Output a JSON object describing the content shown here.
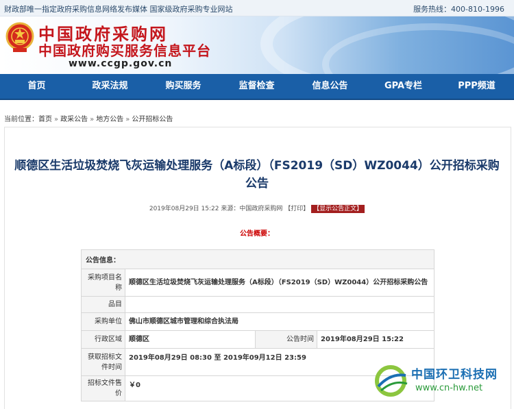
{
  "topbar": {
    "left": "财政部唯一指定政府采购信息网络发布媒体  国家级政府采购专业网站",
    "hotline": "服务热线：400-810-1996"
  },
  "banner": {
    "title1": "中国政府采购网",
    "title2": "中国政府购买服务信息平台",
    "url": "www.ccgp.gov.cn"
  },
  "nav": [
    "首页",
    "政采法规",
    "购买服务",
    "监督检查",
    "信息公告",
    "GPA专栏",
    "PPP频道"
  ],
  "breadcrumb": {
    "prefix": "当前位置：",
    "items": [
      "首页",
      "政采公告",
      "地方公告",
      "公开招标公告"
    ],
    "separator": "»"
  },
  "article": {
    "title": "顺德区生活垃圾焚烧飞灰运输处理服务（A标段）（FS2019（SD）WZ0044）公开招标采购公告",
    "date": "2019年08月29日 15:22",
    "source": "来源：中国政府采购网",
    "print": "【打印】",
    "show_text": "【显示公告正文】",
    "summary_label": "公告概要："
  },
  "table": {
    "section": "公告信息：",
    "rows": {
      "project_name_label": "采购项目名称",
      "project_name": "顺德区生活垃圾焚烧飞灰运输处理服务（A标段）（FS2019（SD）WZ0044）公开招标采购公告",
      "category_label": "品目",
      "category": "",
      "purchaser_label": "采购单位",
      "purchaser": "佛山市顺德区城市管理和综合执法局",
      "region_label": "行政区域",
      "region": "顺德区",
      "pub_time_label": "公告时间",
      "pub_time": "2019年08月29日  15:22",
      "doc_time_label": "获取招标文件时间",
      "doc_time": "2019年08月29日 08:30  至  2019年09月12日 23:59",
      "price_label": "招标文件售价",
      "price": "￥0"
    }
  },
  "watermark": {
    "name": "中国环卫科技网",
    "url": "www.cn-hw.net"
  },
  "colors": {
    "nav_bg": "#1a5fa7",
    "title_red": "#c4161c",
    "article_title": "#1a3a6a",
    "show_btn": "#a31f1f"
  }
}
